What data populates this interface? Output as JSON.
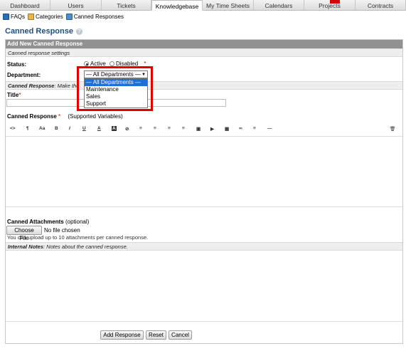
{
  "topnav": {
    "tabs": [
      "Dashboard",
      "Users",
      "Tickets",
      "Knowledgebase",
      "My Time Sheets",
      "Calendars",
      "Projects",
      "Contracts"
    ],
    "active_index": 3
  },
  "subnav": {
    "faqs": "FAQs",
    "categories": "Categories",
    "canned": "Canned Responses"
  },
  "page": {
    "title": "Canned Response",
    "help": "?"
  },
  "form": {
    "header": "Add New Canned Response",
    "settings_sub": "Canned response settings",
    "status_label": "Status:",
    "status_active": "Active",
    "status_disabled": "Disabled",
    "required_mark": "*",
    "department_label": "Department:",
    "canned_sub_label": "Canned Response",
    "canned_sub_text": ": Make the",
    "title_label": "Title",
    "response_label": "Canned Response",
    "supported_vars": "(Supported Variables)",
    "attachments_label": "Canned Attachments",
    "attachments_optional": "(optional)",
    "choose_file": "Choose File",
    "no_file": "No file chosen",
    "upload_note": "You can upload up to 10 attachments per canned response.",
    "internal_notes_label": "Internal Notes",
    "internal_notes_text": ": Notes about the canned response."
  },
  "toolbar": {
    "items": [
      "<>",
      "¶",
      "Aa",
      "B",
      "I",
      "U",
      "A",
      "A",
      "⊘",
      "≡",
      "≡",
      "≡",
      "≡",
      "▣",
      "▶",
      "▦",
      "∞",
      "≡",
      "—"
    ],
    "trash": "🗑"
  },
  "department_select": {
    "selected": "— All Departments —",
    "options": [
      "— All Departments —",
      "Maintenance",
      "Sales",
      "Support"
    ]
  },
  "buttons": {
    "add": "Add Response",
    "reset": "Reset",
    "cancel": "Cancel"
  },
  "colors": {
    "accent_title": "#1f4f80",
    "header_bg": "#919191",
    "highlight": "#e00000",
    "selected_option": "#1e6fd6"
  }
}
